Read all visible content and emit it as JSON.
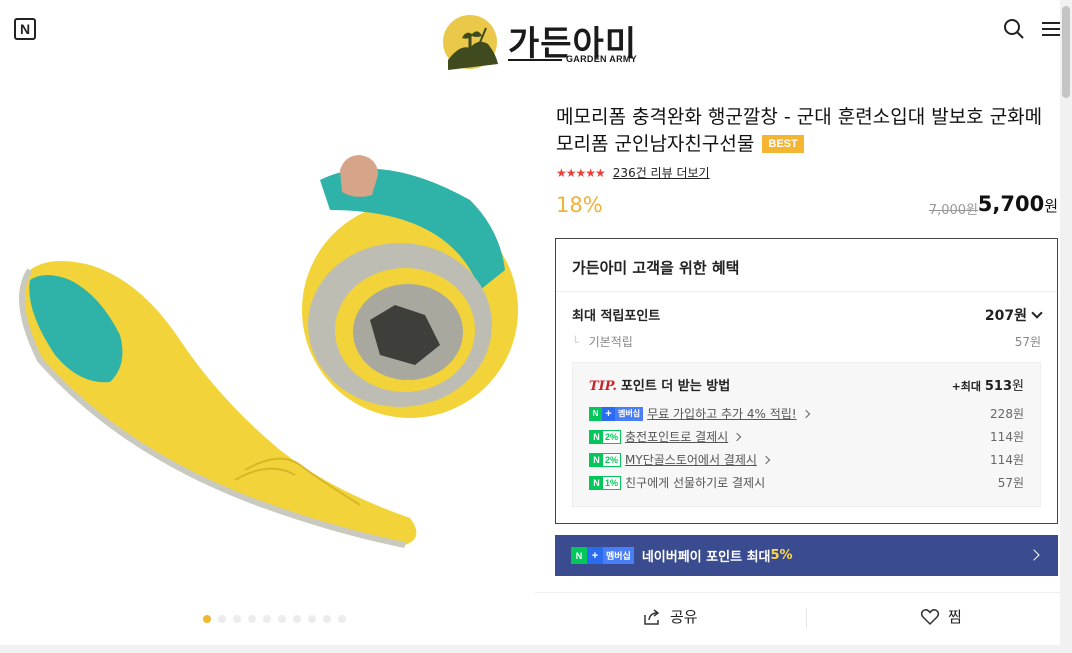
{
  "header": {
    "badge": "N",
    "brand_name": "가든아미",
    "brand_sub": "GARDEN ARMY"
  },
  "product": {
    "title": "메모리폼 충격완화 행군깔창 - 군대 훈련소입대 발보호 군화메모리폼 군인남자친구선물",
    "badge": "BEST",
    "rating_stars": "★★★★★",
    "review_link": "236건 리뷰 더보기",
    "discount": "18%",
    "original_price": "7,000원",
    "sale_price": "5,700",
    "sale_unit": "원"
  },
  "benefits": {
    "title": "가든아미 고객을 위한 혜택",
    "max_label": "최대 적립포인트",
    "max_value": "207원",
    "base_label": "기본적립",
    "base_value": "57원",
    "tip": {
      "word": "TIP.",
      "heading": "포인트 더 받는 방법",
      "max_prefix": "+최대 ",
      "max_value": "513",
      "max_unit": "원",
      "items": [
        {
          "badge": "멤버십",
          "label": "무료 가입하고 추가 4% 적립!",
          "amount": "228원"
        },
        {
          "badge": "2%",
          "label": "충전포인트로 결제시",
          "amount": "114원"
        },
        {
          "badge": "2%",
          "label": "MY단골스토어에서 결제시",
          "amount": "114원"
        },
        {
          "badge": "1%",
          "label": "친구에게 선물하기로 결제시",
          "amount": "57원"
        }
      ]
    }
  },
  "npay": {
    "badge": "멤버십",
    "text": "네이버페이 포인트 최대 ",
    "pct": "5%"
  },
  "actions": {
    "share": "공유",
    "like": "찜"
  },
  "gallery": {
    "active_slide": 1,
    "total_slides": 10
  },
  "colors": {
    "accent": "#f0b03a",
    "naver_green": "#03c75a",
    "npay_banner": "#3a4b8f",
    "star": "#e8413b"
  }
}
